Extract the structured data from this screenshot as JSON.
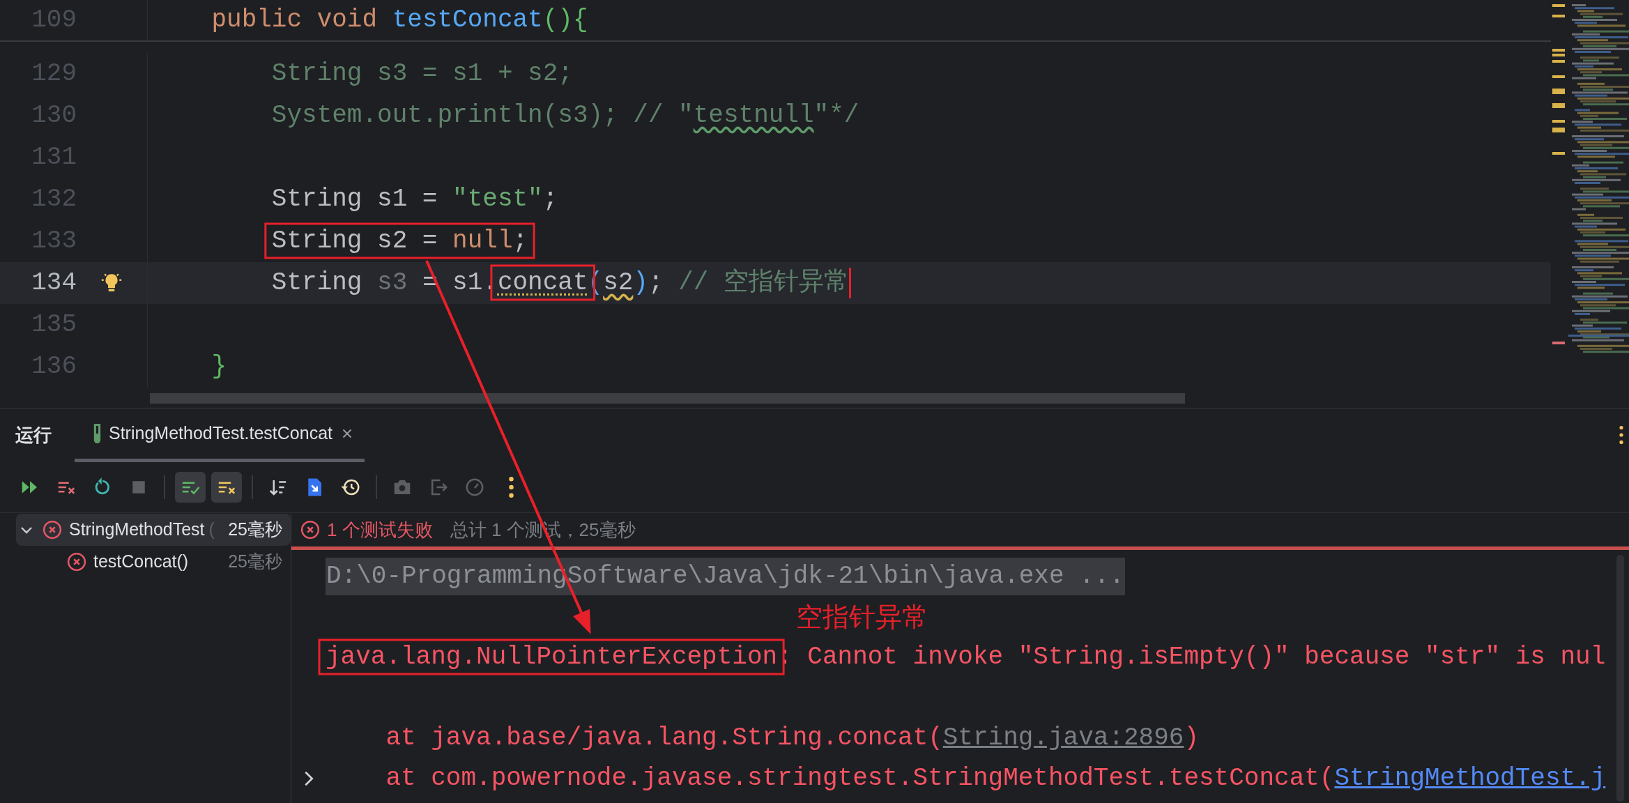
{
  "editor": {
    "sticky": {
      "number": "109",
      "tokens": [
        {
          "text": "    public void ",
          "kind": "keyword"
        },
        {
          "text": "testConcat",
          "kind": "method"
        },
        {
          "text": "(){",
          "kind": "brace"
        }
      ]
    },
    "lines": [
      {
        "number": "129",
        "current": false,
        "tokens": [
          {
            "text": "        String s3 = s1 + s2;",
            "kind": "comment"
          }
        ]
      },
      {
        "number": "130",
        "current": false,
        "tokens": [
          {
            "text": "        System.out.println(s3); // \"",
            "kind": "comment"
          },
          {
            "text": "testnull",
            "kind": "comment",
            "spell_warning": true
          },
          {
            "text": "\"*/",
            "kind": "comment"
          }
        ]
      },
      {
        "number": "131",
        "current": false
      },
      {
        "number": "132",
        "current": false,
        "tokens": [
          {
            "text": "        String s1 = ",
            "kind": "plain"
          },
          {
            "text": "\"test\"",
            "kind": "string"
          },
          {
            "text": ";",
            "kind": "plain"
          }
        ]
      },
      {
        "number": "133",
        "current": false,
        "boxed": true,
        "tokens": [
          {
            "text": "        String s2 = ",
            "kind": "plain"
          },
          {
            "text": "null",
            "kind": "keyword"
          },
          {
            "text": ";",
            "kind": "plain"
          }
        ]
      },
      {
        "number": "134",
        "current": true,
        "bulb": true,
        "caret": true,
        "tokens": [
          {
            "text": "        String ",
            "kind": "plain"
          },
          {
            "text": "s3",
            "kind": "unused"
          },
          {
            "text": " = s1.",
            "kind": "plain"
          },
          {
            "text": "concat",
            "kind": "plain",
            "hint": true,
            "boxed": true
          },
          {
            "text": "(",
            "kind": "paren"
          },
          {
            "text": "s2",
            "kind": "plain",
            "warning": true
          },
          {
            "text": ")",
            "kind": "paren"
          },
          {
            "text": "; ",
            "kind": "plain"
          },
          {
            "text": "// 空指针异常",
            "kind": "comment"
          }
        ]
      },
      {
        "number": "135",
        "current": false
      },
      {
        "number": "136",
        "current": false,
        "tokens": [
          {
            "text": "    }",
            "kind": "brace"
          }
        ]
      }
    ]
  },
  "run_panel": {
    "title": "运行",
    "tabs": [
      {
        "label": "StringMethodTest.testConcat",
        "selected": true
      }
    ],
    "toolbar": [
      {
        "kind": "rerun",
        "disabled": false
      },
      {
        "kind": "rerun-failed",
        "disabled": false
      },
      {
        "kind": "auto",
        "disabled": false
      },
      {
        "kind": "stop",
        "disabled": true
      },
      {
        "kind": "separator"
      },
      {
        "kind": "show-passed",
        "disabled": false,
        "selected": true
      },
      {
        "kind": "show-ignored",
        "disabled": false,
        "selected": true
      },
      {
        "kind": "separator"
      },
      {
        "kind": "sort",
        "disabled": false
      },
      {
        "kind": "import",
        "disabled": false
      },
      {
        "kind": "history",
        "disabled": false
      },
      {
        "kind": "separator"
      },
      {
        "kind": "camera",
        "disabled": true
      },
      {
        "kind": "export",
        "disabled": true
      },
      {
        "kind": "gauge",
        "disabled": true
      },
      {
        "kind": "more",
        "disabled": false
      }
    ],
    "tree": [
      {
        "label": "StringMethodTest",
        "detail": "(",
        "time": "25毫秒",
        "failed": true,
        "expanded": true,
        "selected": true,
        "children": [
          {
            "label": "testConcat()",
            "time": "25毫秒",
            "failed": true,
            "selected": false
          }
        ]
      }
    ],
    "summary": {
      "failed_state": true,
      "failed": "1 个测试失败",
      "total": "总计 1 个测试，25毫秒"
    },
    "progress": {
      "level": 1
    },
    "console": [
      {
        "kind": "command",
        "text": "D:\\0-ProgrammingSoftware\\Java\\jdk-21\\bin\\java.exe ..."
      },
      {
        "kind": "annotation",
        "text": "空指针异常"
      },
      {
        "kind": "output",
        "tokens": [
          {
            "text": "java.lang.NullPointerException",
            "kind": "error",
            "boxed": true
          },
          {
            "text": ": Cannot invoke \"String.isEmpty()\" because \"str\" is nul",
            "kind": "error"
          }
        ]
      },
      {
        "kind": "blank"
      },
      {
        "kind": "stack",
        "folded": false,
        "tokens": [
          {
            "text": "    at java.base/java.lang.String.concat(",
            "kind": "error"
          },
          {
            "text": "String.java:2896",
            "kind": "link-muted"
          },
          {
            "text": ")",
            "kind": "error"
          }
        ]
      },
      {
        "kind": "stack",
        "folded": true,
        "tokens": [
          {
            "text": "    at com.powernode.javase.stringtest.StringMethodTest.testConcat(",
            "kind": "error"
          },
          {
            "text": "StringMethodTest.j",
            "kind": "link"
          }
        ]
      }
    ]
  }
}
